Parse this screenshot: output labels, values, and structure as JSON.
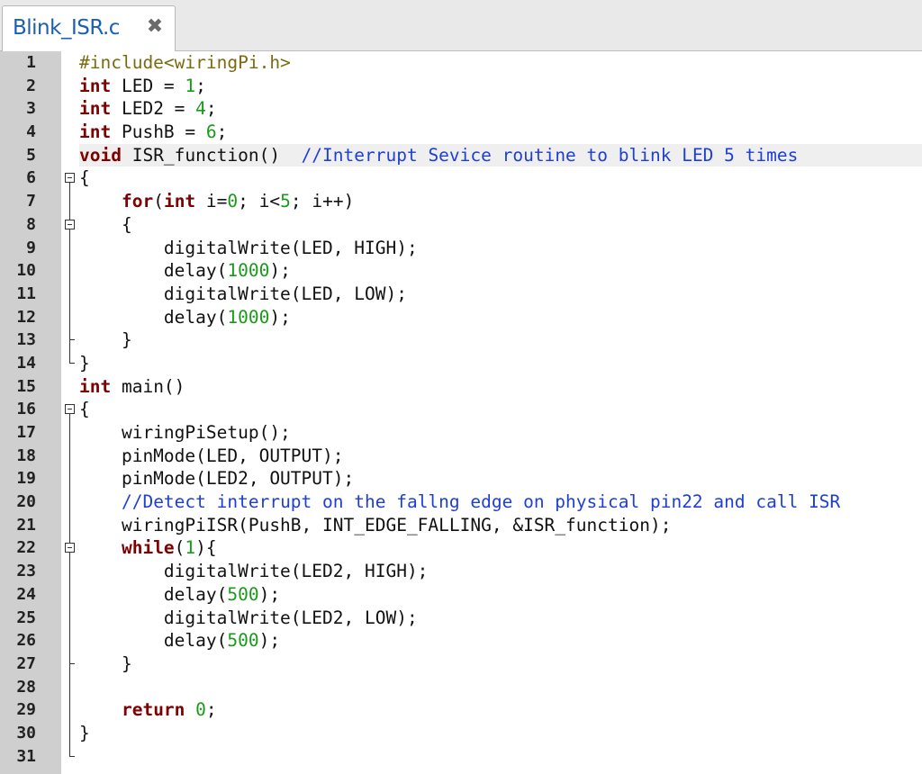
{
  "tab": {
    "title": "Blink_ISR.c",
    "close_icon": "close-icon"
  },
  "editor": {
    "current_line": 5,
    "lines": [
      {
        "n": "1",
        "tokens": [
          {
            "t": "pre",
            "s": "#include<wiringPi.h>"
          }
        ]
      },
      {
        "n": "2",
        "tokens": [
          {
            "t": "kw",
            "s": "int"
          },
          {
            "t": "plain",
            "s": " LED = "
          },
          {
            "t": "num",
            "s": "1"
          },
          {
            "t": "plain",
            "s": ";"
          }
        ]
      },
      {
        "n": "3",
        "tokens": [
          {
            "t": "kw",
            "s": "int"
          },
          {
            "t": "plain",
            "s": " LED2 = "
          },
          {
            "t": "num",
            "s": "4"
          },
          {
            "t": "plain",
            "s": ";"
          }
        ]
      },
      {
        "n": "4",
        "tokens": [
          {
            "t": "kw",
            "s": "int"
          },
          {
            "t": "plain",
            "s": " PushB = "
          },
          {
            "t": "num",
            "s": "6"
          },
          {
            "t": "plain",
            "s": ";"
          }
        ]
      },
      {
        "n": "5",
        "tokens": [
          {
            "t": "kw",
            "s": "void"
          },
          {
            "t": "plain",
            "s": " ISR_function()  "
          },
          {
            "t": "cmt",
            "s": "//Interrupt Sevice routine to blink LED 5 times"
          }
        ]
      },
      {
        "n": "6",
        "tokens": [
          {
            "t": "plain",
            "s": "{"
          }
        ]
      },
      {
        "n": "7",
        "tokens": [
          {
            "t": "plain",
            "s": "    "
          },
          {
            "t": "kw",
            "s": "for"
          },
          {
            "t": "plain",
            "s": "("
          },
          {
            "t": "kw",
            "s": "int"
          },
          {
            "t": "plain",
            "s": " i="
          },
          {
            "t": "num",
            "s": "0"
          },
          {
            "t": "plain",
            "s": "; i<"
          },
          {
            "t": "num",
            "s": "5"
          },
          {
            "t": "plain",
            "s": "; i++)"
          }
        ]
      },
      {
        "n": "8",
        "tokens": [
          {
            "t": "plain",
            "s": "    {"
          }
        ]
      },
      {
        "n": "9",
        "tokens": [
          {
            "t": "plain",
            "s": "        digitalWrite(LED, HIGH);"
          }
        ]
      },
      {
        "n": "10",
        "tokens": [
          {
            "t": "plain",
            "s": "        delay("
          },
          {
            "t": "num",
            "s": "1000"
          },
          {
            "t": "plain",
            "s": ");"
          }
        ]
      },
      {
        "n": "11",
        "tokens": [
          {
            "t": "plain",
            "s": "        digitalWrite(LED, LOW);"
          }
        ]
      },
      {
        "n": "12",
        "tokens": [
          {
            "t": "plain",
            "s": "        delay("
          },
          {
            "t": "num",
            "s": "1000"
          },
          {
            "t": "plain",
            "s": ");"
          }
        ]
      },
      {
        "n": "13",
        "tokens": [
          {
            "t": "plain",
            "s": "    }"
          }
        ]
      },
      {
        "n": "14",
        "tokens": [
          {
            "t": "plain",
            "s": "}"
          }
        ]
      },
      {
        "n": "15",
        "tokens": [
          {
            "t": "kw",
            "s": "int"
          },
          {
            "t": "plain",
            "s": " main()"
          }
        ]
      },
      {
        "n": "16",
        "tokens": [
          {
            "t": "plain",
            "s": "{"
          }
        ]
      },
      {
        "n": "17",
        "tokens": [
          {
            "t": "plain",
            "s": "    wiringPiSetup();"
          }
        ]
      },
      {
        "n": "18",
        "tokens": [
          {
            "t": "plain",
            "s": "    pinMode(LED, OUTPUT);"
          }
        ]
      },
      {
        "n": "19",
        "tokens": [
          {
            "t": "plain",
            "s": "    pinMode(LED2, OUTPUT);"
          }
        ]
      },
      {
        "n": "20",
        "tokens": [
          {
            "t": "plain",
            "s": "    "
          },
          {
            "t": "cmt",
            "s": "//Detect interrupt on the fallng edge on physical pin22 and call ISR"
          }
        ]
      },
      {
        "n": "21",
        "tokens": [
          {
            "t": "plain",
            "s": "    wiringPiISR(PushB, INT_EDGE_FALLING, &ISR_function);"
          }
        ]
      },
      {
        "n": "22",
        "tokens": [
          {
            "t": "plain",
            "s": "    "
          },
          {
            "t": "kw",
            "s": "while"
          },
          {
            "t": "plain",
            "s": "("
          },
          {
            "t": "num",
            "s": "1"
          },
          {
            "t": "plain",
            "s": "){"
          }
        ]
      },
      {
        "n": "23",
        "tokens": [
          {
            "t": "plain",
            "s": "        digitalWrite(LED2, HIGH);"
          }
        ]
      },
      {
        "n": "24",
        "tokens": [
          {
            "t": "plain",
            "s": "        delay("
          },
          {
            "t": "num",
            "s": "500"
          },
          {
            "t": "plain",
            "s": ");"
          }
        ]
      },
      {
        "n": "25",
        "tokens": [
          {
            "t": "plain",
            "s": "        digitalWrite(LED2, LOW);"
          }
        ]
      },
      {
        "n": "26",
        "tokens": [
          {
            "t": "plain",
            "s": "        delay("
          },
          {
            "t": "num",
            "s": "500"
          },
          {
            "t": "plain",
            "s": ");"
          }
        ]
      },
      {
        "n": "27",
        "tokens": [
          {
            "t": "plain",
            "s": "    }"
          }
        ]
      },
      {
        "n": "28",
        "tokens": []
      },
      {
        "n": "29",
        "tokens": [
          {
            "t": "plain",
            "s": "    "
          },
          {
            "t": "kw",
            "s": "return"
          },
          {
            "t": "plain",
            "s": " "
          },
          {
            "t": "num",
            "s": "0"
          },
          {
            "t": "plain",
            "s": ";"
          }
        ]
      },
      {
        "n": "30",
        "tokens": [
          {
            "t": "plain",
            "s": "}"
          }
        ]
      },
      {
        "n": "31",
        "tokens": []
      }
    ],
    "folds": [
      {
        "start": 6,
        "end": 14
      },
      {
        "start": 8,
        "end": 13
      },
      {
        "start": 16,
        "end": 31
      },
      {
        "start": 22,
        "end": 27
      }
    ]
  },
  "colors": {
    "keyword": "#7f0000",
    "number": "#1a9a1a",
    "comment": "#1e3fd6",
    "preprocessor": "#7a6a10",
    "tab_title": "#1a5fb4"
  }
}
